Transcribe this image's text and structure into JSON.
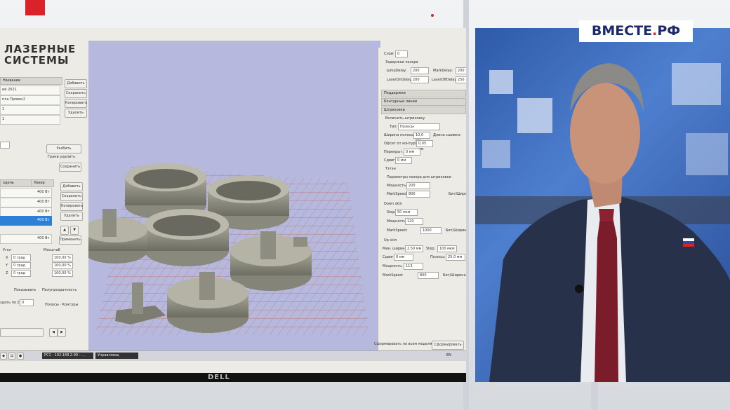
{
  "channel_logo": {
    "left": "ВМЕСТЕ",
    "dot": ".",
    "right": "РФ"
  },
  "monitor_brand": "DELL",
  "app": {
    "title_line1": "ЛАЗЕРНЫЕ",
    "title_line2": "СИСТЕМЫ",
    "left": {
      "table_header": "Название",
      "rows": [
        "ий 2021",
        "пла Провес2",
        "1",
        "1"
      ],
      "buttons": [
        "Добавить",
        "Сохранить",
        "Копировать",
        "Удалить"
      ],
      "slice_button": "Разбить",
      "check_save": "Грани удалить",
      "save2": "Сохранить",
      "table2_header_name": "одель",
      "table2_header_power": "Лазер",
      "table2_rows": [
        "400 Вт",
        "400 Вт",
        "400 Вт",
        "400 Вт",
        "400 Вт"
      ],
      "table2_buttons": [
        "Добавить",
        "Сохранить",
        "Копировать",
        "Удалить"
      ],
      "apply_button": "Применить",
      "rotation_label": "Угол",
      "scale_label": "Масштаб",
      "rot_values": [
        "0 град",
        "0 град",
        "0 град"
      ],
      "scale_values": [
        "100,00 %",
        "100,00 %",
        "100,00 %"
      ],
      "axis_labels": [
        "X",
        "Y",
        "Z"
      ],
      "show_label": "Показывать",
      "transparent_label": "Полупрозрачность",
      "layer_label": "здать по Z:",
      "layer_value": "0",
      "contour_label": "Полосы · Контуры"
    },
    "right": {
      "layer_label": "Слой:",
      "layer_value": "0",
      "delay_header": "Задержки лазера",
      "delays": [
        {
          "name": "JumpDelay:",
          "value": "200"
        },
        {
          "name": "MarkDelay:",
          "value": "200"
        },
        {
          "name": "LaserOnDelay:",
          "value": "200"
        },
        {
          "name": "LaserOffDelay:",
          "value": "250"
        }
      ],
      "sections": [
        "Поддержки",
        "Контурные линии",
        "Штриховки"
      ],
      "enable_hatch": "Включить штриховку",
      "type_label": "Тип:",
      "type_value": "Полосы",
      "params": [
        {
          "name": "Ширина полосы:",
          "value": "10,0 мм"
        },
        {
          "name": "Офсет от контура:",
          "value": "0,05 мм"
        },
        {
          "name": "Перекрыт.:",
          "value": "0 мм"
        },
        {
          "name": "Сдвиг:",
          "value": "0 мм"
        }
      ],
      "stitch_length": "Длина сшивки:",
      "tatan": "Тэтэн",
      "laser_params_header": "Параметры лазера для штриховки",
      "power_label": "Мощность:",
      "power_value": "200",
      "markspeed_label": "MarkSpeed:",
      "markspeed_value": "800",
      "unit_label": "Бит/Ширина",
      "down_skin": "Down skin",
      "down_step": {
        "name": "Step:",
        "value": "50 мкм"
      },
      "down_power": {
        "name": "Мощность:",
        "value": "120"
      },
      "down_speed": {
        "name": "MarkSpeed:",
        "value": "1000"
      },
      "up_skin": "Up skin",
      "up_params": [
        {
          "name": "Мин. ширина:",
          "value": "2,50 мм"
        },
        {
          "name": "Step:",
          "value": "100 мкм"
        },
        {
          "name": "Сдвиг:",
          "value": "0 мм"
        },
        {
          "name": "Полосы:",
          "value": "25,0 мм"
        },
        {
          "name": "Мощность:",
          "value": "113"
        },
        {
          "name": "MarkSpeed:",
          "value": "800"
        }
      ],
      "form_all": "Сформировать по всем моделям",
      "form_button": "Сформировать"
    },
    "taskbar": {
      "tasks": [
        "PC1 - 192.168.2.99 - ...",
        "Управляющ"
      ],
      "lang": "EN"
    }
  }
}
